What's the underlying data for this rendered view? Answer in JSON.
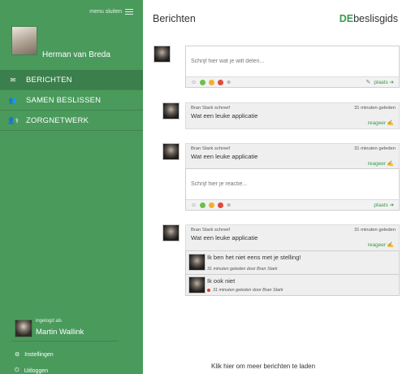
{
  "sidebar": {
    "menu_close": "menu sluiten",
    "profile_name": "Herman van Breda",
    "nav": [
      {
        "label": "BERICHTEN",
        "icon": "mail-icon"
      },
      {
        "label": "SAMEN BESLISSEN",
        "icon": "users-icon"
      },
      {
        "label": "ZORGNETWERK",
        "icon": "network-icon"
      }
    ],
    "logged_in_label": "ingelogd als",
    "logged_in_name": "Martin Wallink",
    "settings": "Instellingen",
    "logout": "Uitloggen"
  },
  "main": {
    "title": "Berichten",
    "brand_strong": "DE",
    "brand_rest": "beslisgids",
    "composer_placeholder": "Schrijf hier wat je wilt delen...",
    "place_label": "plaats",
    "posts": [
      {
        "author": "Bran Stark schreef",
        "time": "31 minuten geleden",
        "text": "Wat een leuke applicatie",
        "reply_label": "reageer"
      },
      {
        "author": "Bran Stark schreef",
        "time": "31 minuten geleden",
        "text": "Wat een leuke applicatie",
        "reply_label": "reageer",
        "reply_placeholder": "Schrijf hier je reactie..."
      },
      {
        "author": "Bran Stark schreef",
        "time": "31 minuten geleden",
        "text": "Wat een leuke applicatie",
        "reply_label": "reageer"
      }
    ],
    "comments": [
      {
        "text": "Ik ben het niet eens met je stelling!",
        "meta": "31 minuten geleden door Bran Stark"
      },
      {
        "text": "Ik ook niet",
        "meta": "31 minuten geleden door Bran Stark"
      }
    ],
    "load_more": "Klik hier om meer berichten te laden"
  },
  "colors": {
    "sidebar": "#4a9a5c",
    "active_nav": "#3b804c",
    "accent": "#3b9b4f"
  }
}
